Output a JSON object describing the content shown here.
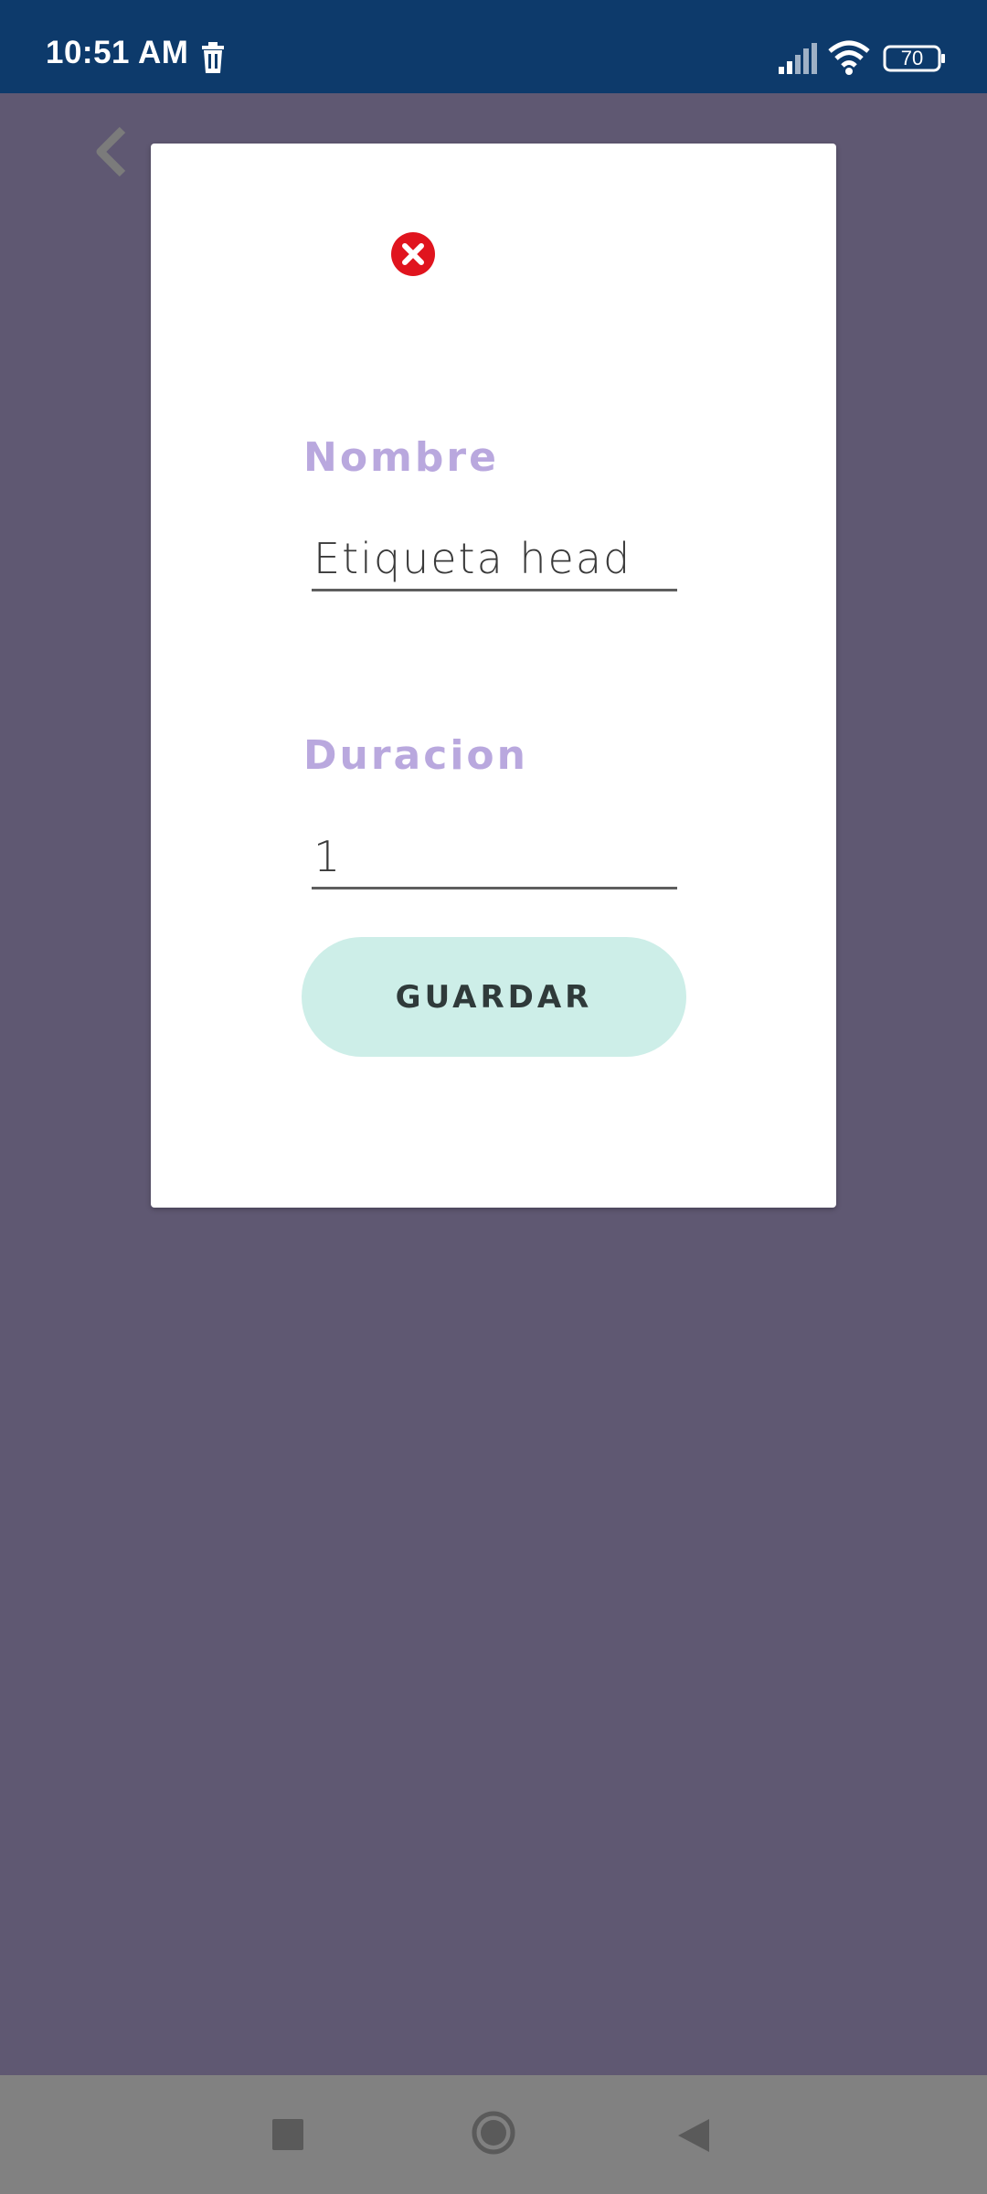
{
  "status_bar": {
    "time": "10:51 AM",
    "battery_level": "70",
    "icons": [
      "trash-icon",
      "signal-icon",
      "wifi-icon",
      "battery-icon"
    ]
  },
  "background": {
    "back_icon": "chevron-left-icon"
  },
  "dialog": {
    "close_icon": "close-icon",
    "nombre_label": "Nombre",
    "nombre_value": "Etiqueta head",
    "duracion_label": "Duracion",
    "duracion_value": "1",
    "save_label": "GUARDAR"
  },
  "nav_bar": {
    "icons": [
      "recent-apps-icon",
      "home-icon",
      "back-icon"
    ]
  },
  "colors": {
    "status_bar": "#0d3a6b",
    "overlay": "#5f5872",
    "label": "#b9a8de",
    "save_button": "#cdeee8",
    "close": "#e0141e",
    "nav_bar": "#818181"
  }
}
